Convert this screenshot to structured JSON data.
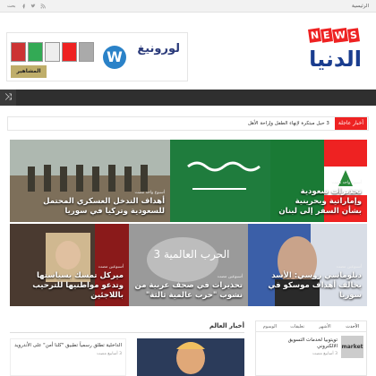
{
  "topbar": {
    "home": "الرئيسية",
    "left_text": "بحث"
  },
  "logo": {
    "news": [
      "N",
      "E",
      "W",
      "S"
    ],
    "arabic": "الدنيا"
  },
  "ad": {
    "text": "لورونيغ",
    "w": "W",
    "brand": "المشاهير"
  },
  "navbar": {
    "shuffle": "⤨"
  },
  "ticker": {
    "label": "أخبار عاجلة",
    "message": "3 حيل مبتكرة لإنهاء الطفل وإراحة الأهل"
  },
  "tiles": [
    {
      "date": "أسبوع واحد مضت",
      "title": "تحذيرات سعودية وإماراتية وبحرينية بشأن السفر إلى لبنان"
    },
    {
      "date": "",
      "title": ""
    },
    {
      "date": "أسبوع واحد مضت",
      "title": "أهداف التدخل العسكري المحتمل للسعودية وتركيا في سوريا"
    },
    {
      "date": "أسبوعين مضت",
      "title": "دبلوماسي روسي: الأسد يخالف أهداف موسكو في سوريا"
    },
    {
      "date": "أسبوعين مضت",
      "title": "تحذيرات في صحف عربية من نشوب \"حرب عالمية ثالثة\""
    },
    {
      "date": "أسبوعين مضت",
      "title": "ميركل تمسك بسياستها وتدعو مواطنيها للترحيب باللاجئين"
    }
  ],
  "widget": {
    "tabs": [
      "الأحدث",
      "الأشهر",
      "تعليقات",
      "الوسوم"
    ],
    "item_title": "تويتوبيا لخدمات التسويق الالكتروني",
    "item_date": "3 أسابيع مضت",
    "thumb_label": "market"
  },
  "news_block": {
    "heading": "أخبار العالم",
    "item_title": "الداخلية تطلق رسمياً تطبيق \"كلنا أمن\" على الأندرويد",
    "item_date": "3 أسابيع مضت"
  }
}
